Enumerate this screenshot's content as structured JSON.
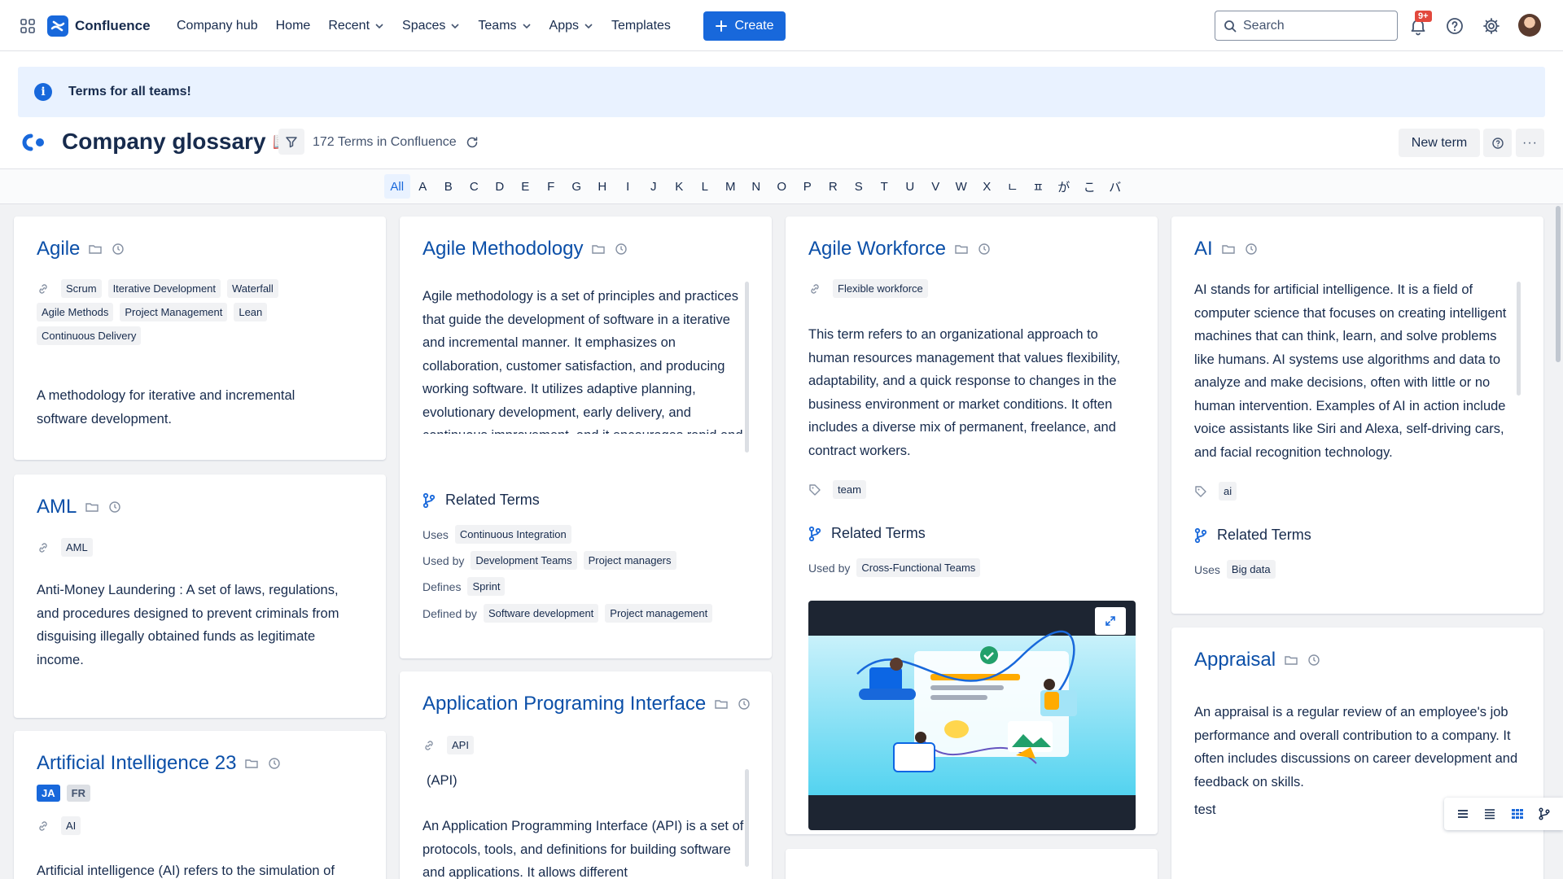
{
  "topnav": {
    "product": "Confluence",
    "items": [
      {
        "label": "Company hub",
        "dropdown": false
      },
      {
        "label": "Home",
        "dropdown": false
      },
      {
        "label": "Recent",
        "dropdown": true
      },
      {
        "label": "Spaces",
        "dropdown": true
      },
      {
        "label": "Teams",
        "dropdown": true
      },
      {
        "label": "Apps",
        "dropdown": true
      },
      {
        "label": "Templates",
        "dropdown": false
      }
    ],
    "create_label": "Create",
    "search_placeholder": "Search",
    "notifications_badge": "9+"
  },
  "banner": {
    "text": "Terms for all teams!"
  },
  "header": {
    "title": "Company glossary",
    "title_emoji": "📖",
    "term_count": "172 Terms in Confluence",
    "new_term_label": "New term",
    "more_label": "···"
  },
  "alphabet": [
    "All",
    "A",
    "B",
    "C",
    "D",
    "E",
    "F",
    "G",
    "H",
    "I",
    "J",
    "K",
    "L",
    "M",
    "N",
    "O",
    "P",
    "R",
    "S",
    "T",
    "U",
    "V",
    "W",
    "X",
    "ㄴ",
    "ㅍ",
    "が",
    "こ",
    "バ"
  ],
  "alphabet_active": "All",
  "cards": {
    "agile": {
      "title": "Agile",
      "tags": [
        "Scrum",
        "Iterative Development",
        "Waterfall",
        "Agile Methods",
        "Project Management",
        "Lean",
        "Continuous Delivery"
      ],
      "body": "A methodology for iterative and incremental software development."
    },
    "aml": {
      "title": "AML",
      "tags": [
        "AML"
      ],
      "body": "Anti-Money Laundering : A set of laws, regulations, and procedures designed to prevent criminals from disguising illegally obtained funds as legitimate income."
    },
    "ai23": {
      "title": "Artificial Intelligence 23",
      "langs": [
        "JA",
        "FR"
      ],
      "tags": [
        "AI"
      ],
      "body": "Artificial intelligence (AI) refers to the simulation of"
    },
    "agile_methodology": {
      "title": "Agile Methodology",
      "body": "Agile methodology is a set of principles and practices that guide the development of software in a iterative and incremental manner. It emphasizes on collaboration, customer satisfaction, and producing working software. It utilizes adaptive planning, evolutionary development, early delivery, and continuous improvement, and it encourages rapid and flexible response to change.",
      "related_heading": "Related Terms",
      "related": [
        {
          "label": "Uses",
          "terms": [
            "Continuous Integration"
          ]
        },
        {
          "label": "Used by",
          "terms": [
            "Development Teams",
            "Project managers"
          ]
        },
        {
          "label": "Defines",
          "terms": [
            "Sprint"
          ]
        },
        {
          "label": "Defined by",
          "terms": [
            "Software development",
            "Project management"
          ]
        }
      ]
    },
    "api": {
      "title": "Application Programing Interface",
      "tags": [
        "API"
      ],
      "abbr": "(API)",
      "body": "An Application Programming Interface (API) is a set of protocols, tools, and definitions for building software and applications. It allows different"
    },
    "agile_workforce": {
      "title": "Agile Workforce",
      "tags": [
        "Flexible workforce"
      ],
      "body": "This term refers to an organizational approach to human resources management that values flexibility, adaptability, and a quick response to changes in the business environment or market conditions. It often includes a diverse mix of permanent, freelance, and contract workers.",
      "labels": [
        "team"
      ],
      "related_heading": "Related Terms",
      "related": [
        {
          "label": "Used by",
          "terms": [
            "Cross-Functional Teams"
          ]
        }
      ]
    },
    "ai": {
      "title": "AI",
      "body": "AI stands for artificial intelligence. It is a field of computer science that focuses on creating intelligent machines that can think, learn, and solve problems like humans. AI systems use algorithms and data to analyze and make decisions, often with little or no human intervention. Examples of AI in action include voice assistants like Siri and Alexa, self-driving cars, and facial recognition technology.",
      "labels": [
        "ai"
      ],
      "related_heading": "Related Terms",
      "related": [
        {
          "label": "Uses",
          "terms": [
            "Big data"
          ]
        }
      ]
    },
    "appraisal": {
      "title": "Appraisal",
      "body": "An appraisal is a regular review of an employee's job performance and overall contribution to a company. It often includes discussions on career development and feedback on skills.",
      "extra": "test"
    }
  },
  "colors": {
    "brand": "#1868db",
    "title_link": "#0b4fa8",
    "banner_bg": "#e9f2ff",
    "canvas": "#f1f2f4"
  }
}
